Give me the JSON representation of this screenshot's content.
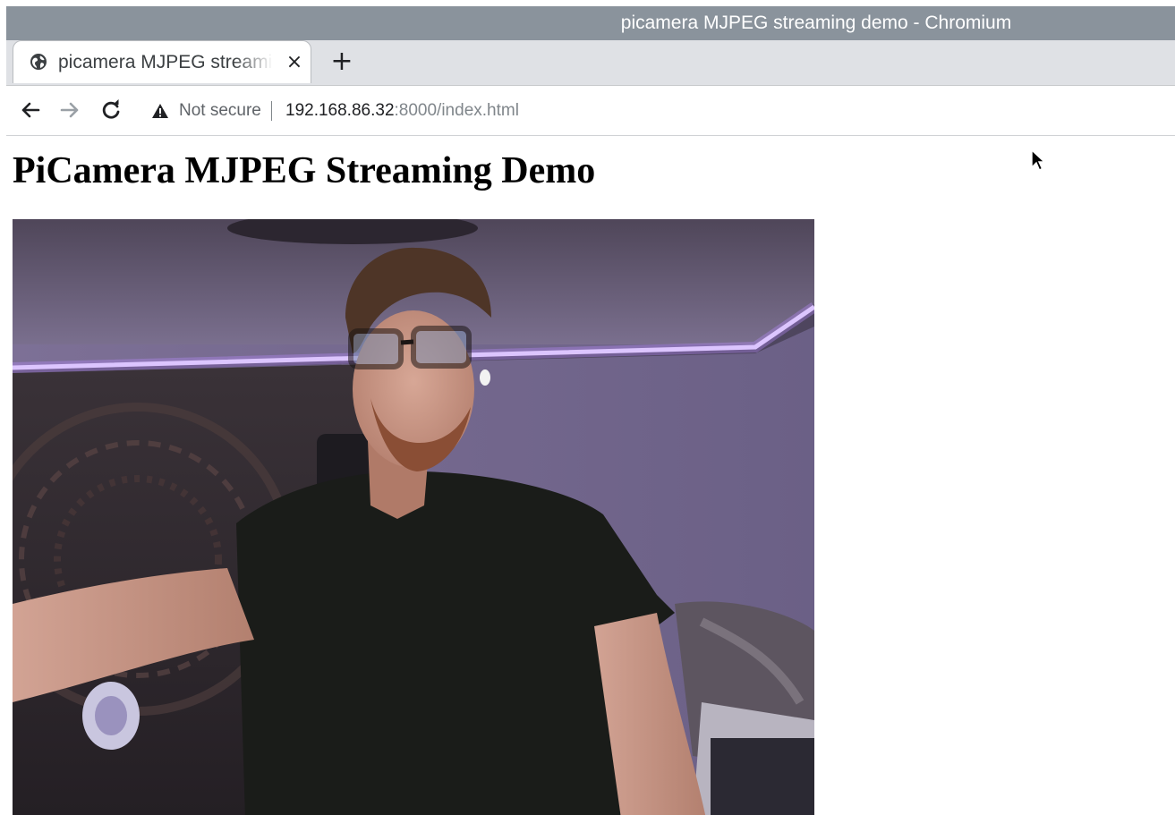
{
  "window": {
    "title": "picamera MJPEG streaming demo - Chromium"
  },
  "tabs": [
    {
      "title": "picamera MJPEG streaming demo",
      "favicon": "globe-icon",
      "close_label": "×"
    }
  ],
  "new_tab_label": "+",
  "toolbar": {
    "back_icon": "arrow-left-icon",
    "forward_icon": "arrow-right-icon",
    "reload_icon": "reload-icon"
  },
  "address_bar": {
    "security_icon": "warning-triangle-icon",
    "security_label": "Not secure",
    "url_host": "192.168.86.32",
    "url_rest": ":8000/index.html"
  },
  "page": {
    "heading": "PiCamera MJPEG Streaming Demo",
    "stream_image": "live camera frame: person in black t-shirt and glasses in a room with purple LED strip lights"
  },
  "colors": {
    "title_bar": "#8a939c",
    "tab_strip": "#dfe1e5",
    "led_strip": "#c9a8ff",
    "wall": "#6d6385"
  }
}
